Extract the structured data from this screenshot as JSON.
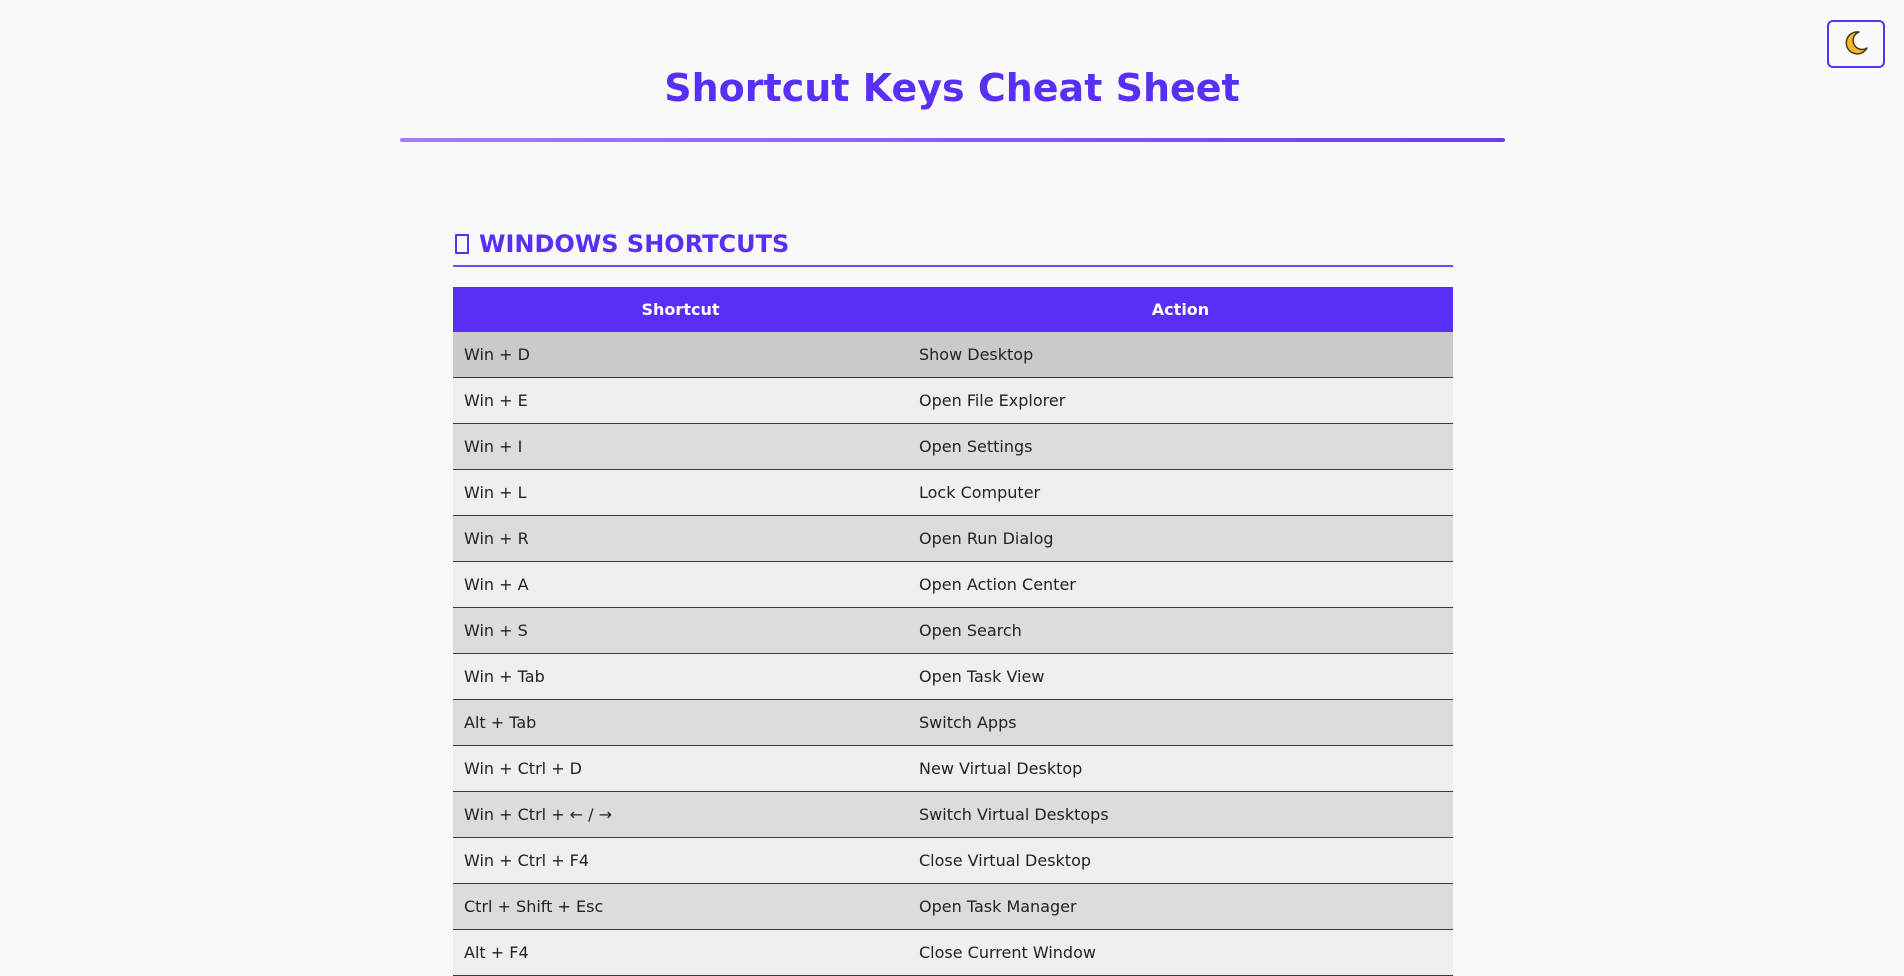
{
  "header": {
    "title": "Shortcut Keys Cheat Sheet",
    "theme_toggle_icon": "moon-icon"
  },
  "section": {
    "icon": "square-icon",
    "heading": "WINDOWS SHORTCUTS",
    "columns": [
      "Shortcut",
      "Action"
    ],
    "rows": [
      {
        "shortcut": "Win + D",
        "action": "Show Desktop"
      },
      {
        "shortcut": "Win + E",
        "action": "Open File Explorer"
      },
      {
        "shortcut": "Win + I",
        "action": "Open Settings"
      },
      {
        "shortcut": "Win + L",
        "action": "Lock Computer"
      },
      {
        "shortcut": "Win + R",
        "action": "Open Run Dialog"
      },
      {
        "shortcut": "Win + A",
        "action": "Open Action Center"
      },
      {
        "shortcut": "Win + S",
        "action": "Open Search"
      },
      {
        "shortcut": "Win + Tab",
        "action": "Open Task View"
      },
      {
        "shortcut": "Alt + Tab",
        "action": "Switch Apps"
      },
      {
        "shortcut": "Win + Ctrl + D",
        "action": "New Virtual Desktop"
      },
      {
        "shortcut": "Win + Ctrl + ← / →",
        "action": "Switch Virtual Desktops"
      },
      {
        "shortcut": "Win + Ctrl + F4",
        "action": "Close Virtual Desktop"
      },
      {
        "shortcut": "Ctrl + Shift + Esc",
        "action": "Open Task Manager"
      },
      {
        "shortcut": "Alt + F4",
        "action": "Close Current Window"
      }
    ]
  },
  "colors": {
    "accent": "#5a2ff5",
    "moon": "#f5b82e"
  }
}
